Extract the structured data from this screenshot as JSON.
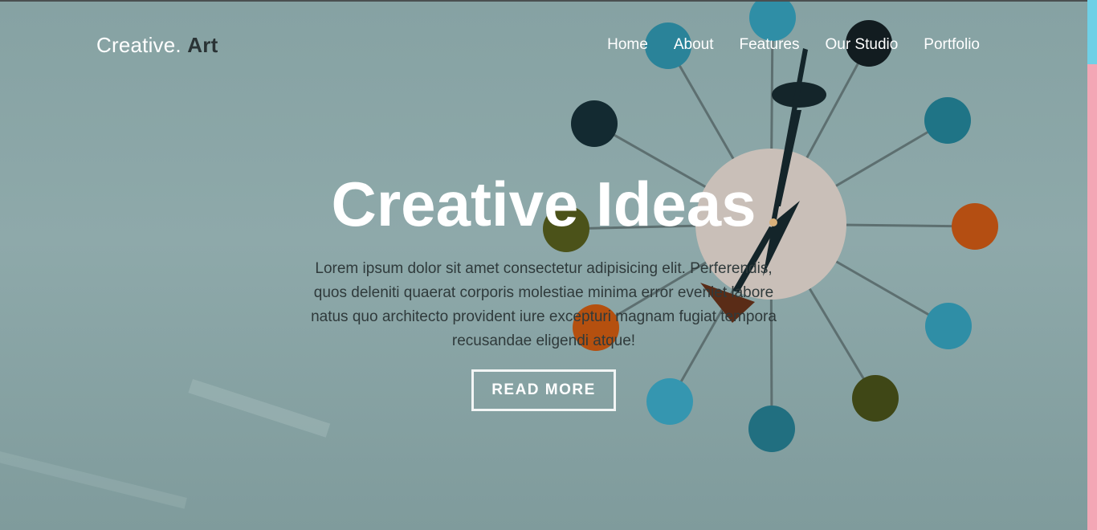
{
  "brand": {
    "name": "Creative.",
    "accent": "Art"
  },
  "nav": {
    "items": [
      "Home",
      "About",
      "Features",
      "Our Studio",
      "Portfolio"
    ]
  },
  "hero": {
    "title": "Creative Ideas",
    "description": "Lorem ipsum dolor sit amet consectetur adipisicing elit. Perferendis, quos deleniti quaerat corporis molestiae minima error eveniet labore natus quo architecto provident iure excepturi magnam fugiat tempora recusandae eligendi atque!",
    "button_label": "READ MORE"
  },
  "colors": {
    "overlay": "#8ea9aa",
    "strip_top": "#6fd0e6",
    "strip_bottom": "#f3a6b5",
    "accent_dark": "#2a3335"
  },
  "icons": {
    "clock": "ball-clock-illustration"
  }
}
